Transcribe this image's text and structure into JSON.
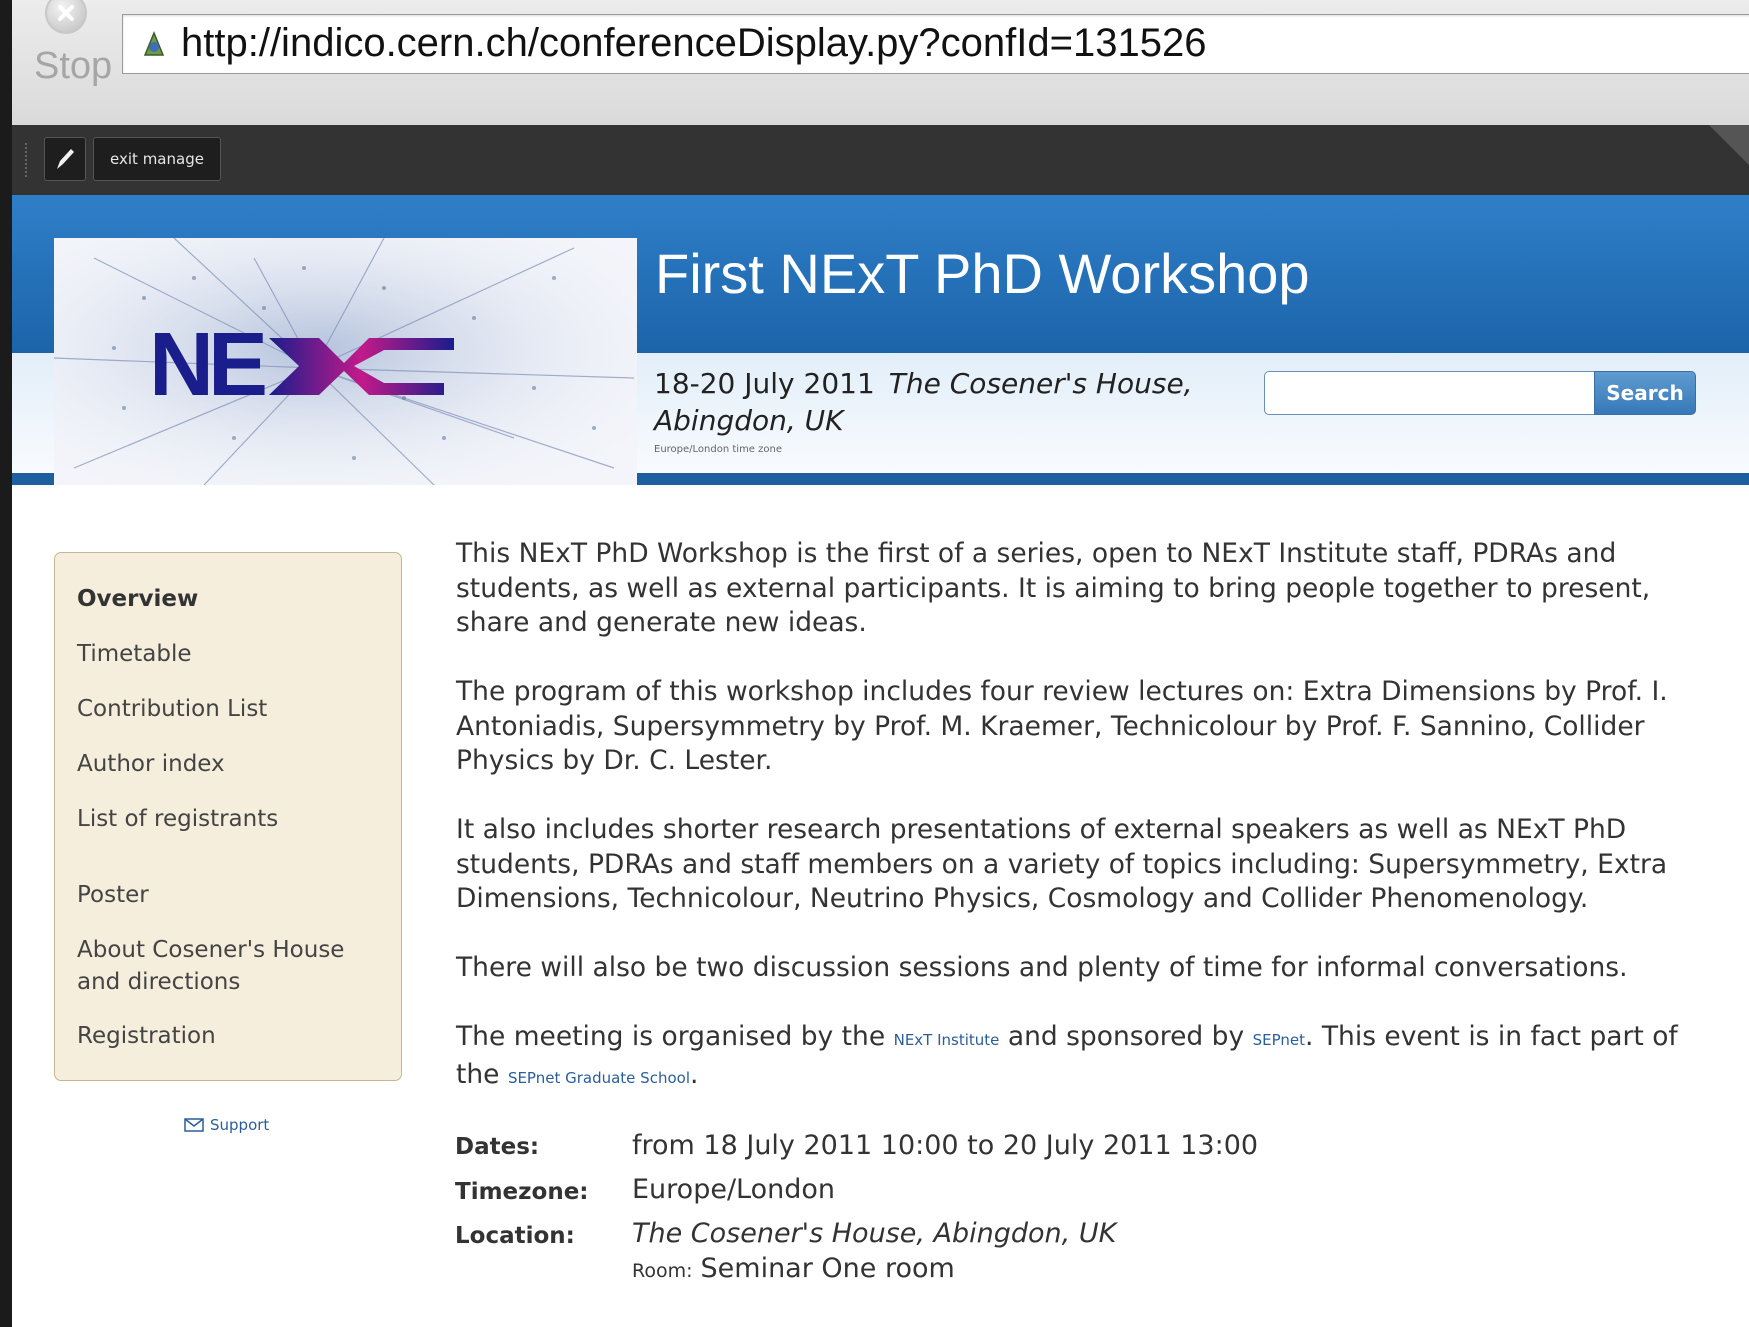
{
  "browser": {
    "stop_label": "Stop",
    "url": "http://indico.cern.ch/conferenceDisplay.py?confId=131526"
  },
  "manage_bar": {
    "exit_label": "exit manage"
  },
  "header": {
    "title": "First NExT PhD Workshop",
    "dates": "18-20 July 2011",
    "venue_line1": "The Cosener's House,",
    "venue_line2": "Abingdon, UK",
    "timezone_note": "Europe/London time zone",
    "logo_text": "NExT",
    "search_button": "Search",
    "search_value": ""
  },
  "sidebar": {
    "items": [
      {
        "label": "Overview",
        "active": true
      },
      {
        "label": "Timetable"
      },
      {
        "label": "Contribution List"
      },
      {
        "label": "Author index"
      },
      {
        "label": "List of registrants"
      },
      {
        "label": "Poster"
      },
      {
        "label_line1": "About Cosener's House",
        "label_line2": "and directions"
      },
      {
        "label": "Registration"
      }
    ],
    "support_label": "Support"
  },
  "description": {
    "p1": "This NExT PhD Workshop is the first of a series, open to NExT Institute staff, PDRAs and students, as well as external participants. It is aiming to bring people together to present, share and generate new ideas.",
    "p2": "The program of this workshop includes four review lectures on: Extra Dimensions by Prof. I. Antoniadis, Supersymmetry by Prof. M. Kraemer, Technicolour by Prof. F. Sannino, Collider Physics by Dr. C. Lester.",
    "p3": "It also includes shorter research presentations of external speakers as well as NExT PhD students, PDRAs and staff members on a variety of topics including: Supersymmetry, Extra Dimensions, Technicolour, Neutrino Physics, Cosmology and Collider Phenomenology.",
    "p4": "There will also be two discussion sessions and plenty of time for informal conversations.",
    "p5_part1": "The meeting is organised by the",
    "link_next": "NExT Institute",
    "p5_part2": "and sponsored by",
    "link_sepnet": "SEPnet",
    "p5_part3": ". This event is in fact part of the",
    "link_school": "SEPnet Graduate School",
    "p5_end": "."
  },
  "details": {
    "dates_label": "Dates:",
    "dates_value": "from 18 July 2011 10:00 to 20 July 2011 13:00",
    "timezone_label": "Timezone:",
    "timezone_value": "Europe/London",
    "location_label": "Location:",
    "location_value": "The Cosener's House, Abingdon, UK",
    "room_label": "Room:",
    "room_value": "Seminar One room"
  },
  "colors": {
    "header_blue": "#1c64aa",
    "sidebar_bg": "#f6eedc",
    "link": "#2a5e9a",
    "logo_navy": "#1a1d8c",
    "logo_magenta": "#c21a8a"
  },
  "icons": [
    "stop-icon",
    "site-icon",
    "pencil-icon",
    "envelope-icon"
  ]
}
